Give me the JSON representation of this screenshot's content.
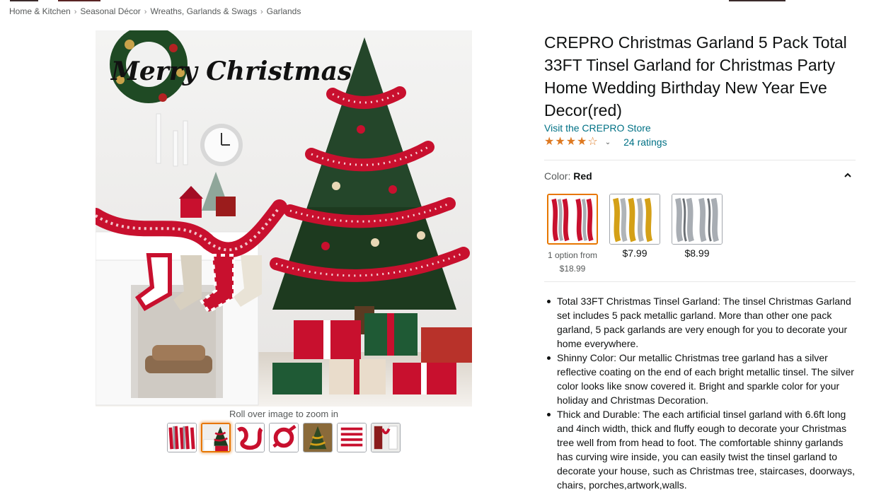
{
  "breadcrumb": [
    "Home & Kitchen",
    "Seasonal Décor",
    "Wreaths, Garlands & Swags",
    "Garlands"
  ],
  "image": {
    "overlay_text": "Merry Christmas",
    "zoom_hint": "Roll over image to zoom in",
    "thumbnail_count": 7,
    "selected_thumbnail": 2
  },
  "product": {
    "title": "CREPRO Christmas Garland 5 Pack Total 33FT Tinsel Garland for Christmas Party Home Wedding Birthday New Year Eve Decor(red)",
    "store_link": "Visit the CREPRO Store",
    "rating_stars": 4,
    "ratings_count": "24 ratings"
  },
  "variation": {
    "label": "Color: ",
    "selected_value": "Red",
    "options": [
      {
        "name": "Red",
        "price": "",
        "note_line1": "1 option from",
        "note_line2": "$18.99",
        "accent": "#c8102e"
      },
      {
        "name": "Gold",
        "price": "$7.99",
        "accent": "#d4a017"
      },
      {
        "name": "Silver",
        "price": "$8.99",
        "accent": "#a8adb3"
      }
    ]
  },
  "bullets": [
    "Total 33FT Christmas Tinsel Garland: The tinsel Christmas Garland set includes 5 pack metallic garland. More than other one pack garland, 5 pack garlands are very enough for you to decorate your home everywhere.",
    "Shinny Color: Our metallic Christmas tree garland has a silver reflective coating on the end of each bright metallic tinsel. The silver color looks like snow covered it. Bright and sparkle color for your holiday and Christmas Decoration.",
    "Thick and Durable: The each artificial tinsel garland with 6.6ft long and 4inch width, thick and fluffy eough to decorate your Christmas tree well from from head to foot. The comfortable shinny garlands has curving wire inside, you can easily twist the tinsel garland to decorate your house, such as Christmas tree, staircases, doorways, chairs, porches,artwork,walls."
  ],
  "colors": {
    "link": "#007185",
    "star": "#de7921",
    "selected_border": "#e77600",
    "text": "#0f1111",
    "muted": "#565959"
  }
}
